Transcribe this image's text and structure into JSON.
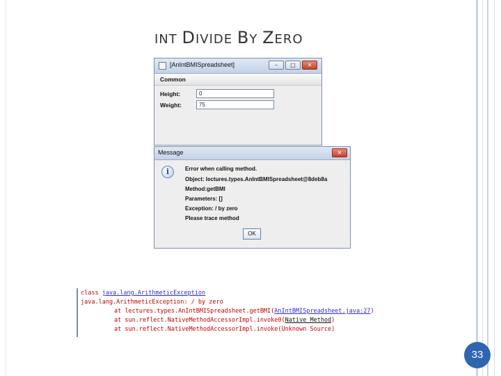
{
  "slide": {
    "title_parts": [
      "INT ",
      "D",
      "IVIDE ",
      "B",
      "Y ",
      "Z",
      "ERO"
    ],
    "page_number": "33"
  },
  "window1": {
    "title": "[AnIntBMISpreadsheet]",
    "buttons": {
      "minimize": "–",
      "maximize": "□",
      "close": "✕"
    },
    "panel_header": "Common",
    "height_label": "Height:",
    "height_value": "0",
    "weight_label": "Weight:",
    "weight_value": "75"
  },
  "dialog": {
    "title": "Message",
    "close": "✕",
    "icon": "i",
    "lines": [
      "Error when calling method.",
      "Object: lectures.types.AnIntBMISpreadsheet@8deb8a",
      "Method:getBMI",
      "Parameters: []",
      "Exception: / by zero",
      "Please trace method"
    ],
    "ok_label": "OK"
  },
  "console": {
    "line1_prefix": "class ",
    "line1_link": "java.lang.ArithmeticException",
    "line2": "java.lang.ArithmeticException: / by zero",
    "line3_prefix": "at lectures.types.AnIntBMISpreadsheet.getBMI(",
    "line3_link": "AnIntBMISpreadsheet.java:27",
    "line3_suffix": ")",
    "line4_prefix": "at sun.reflect.NativeMethodAccessorImpl.invoke0(",
    "line4_link": "Native Method",
    "line4_suffix": ")",
    "line5": "at sun.reflect.NativeMethodAccessorImpl.invoke(Unknown Source)"
  },
  "colors": {
    "accent": "#2f66b0",
    "error_text": "#c00000",
    "link": "#2b2bd6"
  }
}
